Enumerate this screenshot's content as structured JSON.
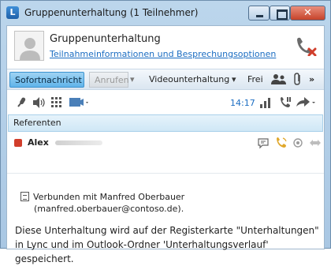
{
  "window": {
    "title": "Gruppenunterhaltung (1 Teilnehmer)",
    "app_icon": "lync-icon",
    "close_glyph": "✕"
  },
  "header": {
    "title": "Gruppenunterhaltung",
    "link": "Teilnahmeinformationen und Besprechungsoptionen"
  },
  "tabs": {
    "im": "Sofortnachricht",
    "call": "Anrufen",
    "dropdown_glyph": "▾",
    "video": "Videounterhaltung",
    "free": "Frei",
    "more": "»"
  },
  "calltools": {
    "time": "14:17"
  },
  "presenters": {
    "label": "Referenten"
  },
  "participant": {
    "name": "Alex",
    "status_color": "#d13e2b"
  },
  "messages": {
    "system_line1": "Verbunden mit Manfred Oberbauer",
    "system_line2": "(manfred.oberbauer@contoso.de).",
    "info": "Diese Unterhaltung wird auf der Registerkarte \"Unterhaltungen\" in Lync und im Outlook-Ordner 'Unterhaltungsverlauf' gespeichert."
  },
  "colors": {
    "accent": "#1b6dc2",
    "active_tab": "#60b4ea",
    "hangup": "#d13e2b"
  }
}
